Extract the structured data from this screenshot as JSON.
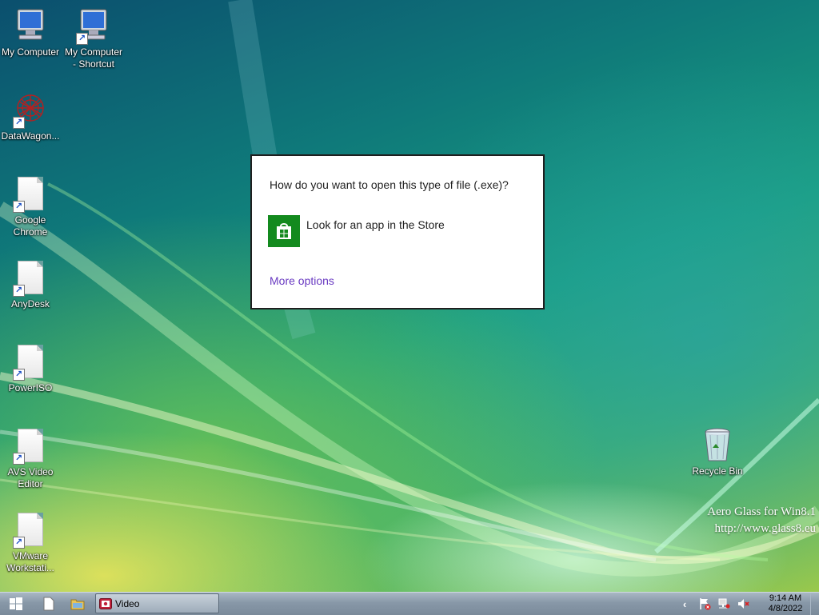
{
  "desktop": {
    "icons": [
      {
        "label": "My Computer"
      },
      {
        "label": "My Computer - Shortcut"
      },
      {
        "label": "DataWagon..."
      },
      {
        "label": "Google Chrome"
      },
      {
        "label": "AnyDesk"
      },
      {
        "label": "PowerISO"
      },
      {
        "label": "AVS Video Editor"
      },
      {
        "label": "VMware Workstati..."
      },
      {
        "label": "Recycle Bin"
      }
    ],
    "watermark": {
      "line1": "Aero Glass for Win8.1",
      "line2": "http://www.glass8.eu"
    }
  },
  "dialog": {
    "question": "How do you want to open this type of file (.exe)?",
    "store_option": "Look for an app in the Store",
    "more_options": "More options"
  },
  "taskbar": {
    "task_label": "Video",
    "clock_time": "9:14 AM",
    "clock_date": "4/8/2022"
  }
}
